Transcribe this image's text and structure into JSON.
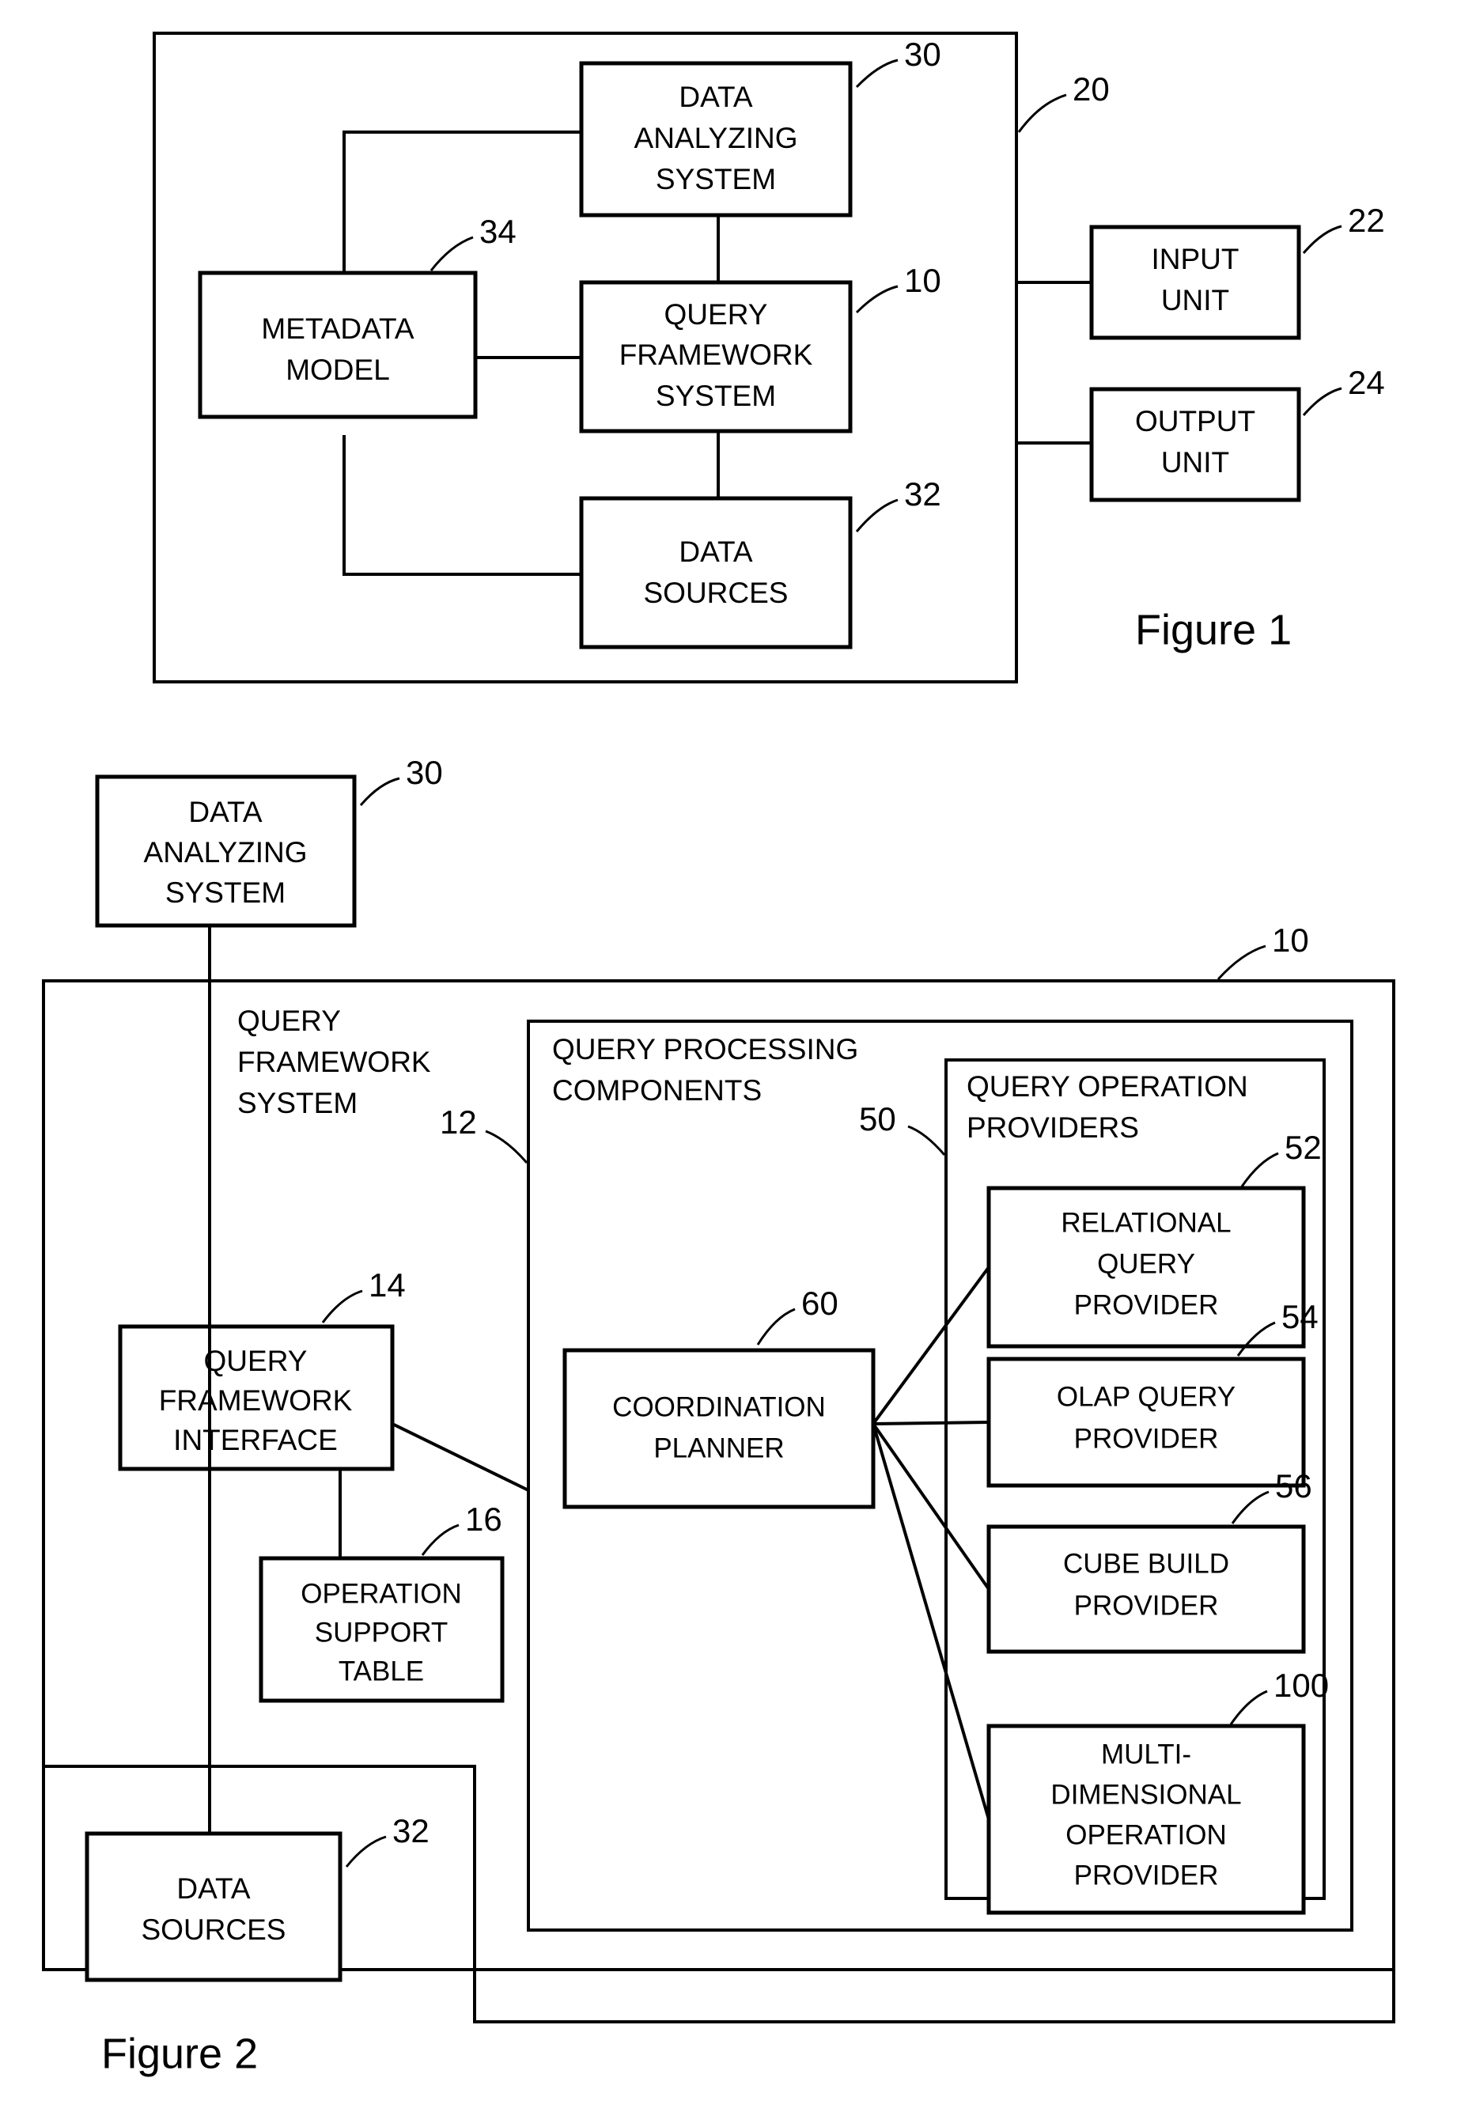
{
  "figure1": {
    "caption": "Figure 1",
    "outer_ref": "20",
    "boxes": [
      {
        "id": "data-analyzing-system",
        "label_lines": [
          "DATA",
          "ANALYZING",
          "SYSTEM"
        ],
        "ref": "30"
      },
      {
        "id": "metadata-model",
        "label_lines": [
          "METADATA",
          "MODEL"
        ],
        "ref": "34"
      },
      {
        "id": "query-framework-system",
        "label_lines": [
          "QUERY",
          "FRAMEWORK",
          "SYSTEM"
        ],
        "ref": "10"
      },
      {
        "id": "data-sources",
        "label_lines": [
          "DATA",
          "SOURCES"
        ],
        "ref": "32"
      },
      {
        "id": "input-unit",
        "label_lines": [
          "INPUT",
          "UNIT"
        ],
        "ref": "22"
      },
      {
        "id": "output-unit",
        "label_lines": [
          "OUTPUT",
          "UNIT"
        ],
        "ref": "24"
      }
    ]
  },
  "figure2": {
    "caption": "Figure 2",
    "boxes": [
      {
        "id": "data-analyzing-system",
        "label_lines": [
          "DATA",
          "ANALYZING",
          "SYSTEM"
        ],
        "ref": "30"
      },
      {
        "id": "query-framework-system",
        "label_lines": [
          "QUERY",
          "FRAMEWORK",
          "SYSTEM"
        ],
        "ref": "10"
      },
      {
        "id": "query-processing-components",
        "label_lines": [
          "QUERY PROCESSING",
          "COMPONENTS"
        ],
        "ref": "12"
      },
      {
        "id": "query-operation-providers",
        "label_lines": [
          "QUERY OPERATION",
          "PROVIDERS"
        ],
        "ref": "50"
      },
      {
        "id": "query-framework-interface",
        "label_lines": [
          "QUERY",
          "FRAMEWORK",
          "INTERFACE"
        ],
        "ref": "14"
      },
      {
        "id": "operation-support-table",
        "label_lines": [
          "OPERATION",
          "SUPPORT",
          "TABLE"
        ],
        "ref": "16"
      },
      {
        "id": "coordination-planner",
        "label_lines": [
          "COORDINATION",
          "PLANNER"
        ],
        "ref": "60"
      },
      {
        "id": "relational-query-provider",
        "label_lines": [
          "RELATIONAL",
          "QUERY",
          "PROVIDER"
        ],
        "ref": "52"
      },
      {
        "id": "olap-query-provider",
        "label_lines": [
          "OLAP QUERY",
          "PROVIDER"
        ],
        "ref": "54"
      },
      {
        "id": "cube-build-provider",
        "label_lines": [
          "CUBE BUILD",
          "PROVIDER"
        ],
        "ref": "56"
      },
      {
        "id": "multidimensional-operation-provider",
        "label_lines": [
          "MULTI-",
          "DIMENSIONAL",
          "OPERATION",
          "PROVIDER"
        ],
        "ref": "100"
      },
      {
        "id": "data-sources",
        "label_lines": [
          "DATA",
          "SOURCES"
        ],
        "ref": "32"
      }
    ]
  }
}
